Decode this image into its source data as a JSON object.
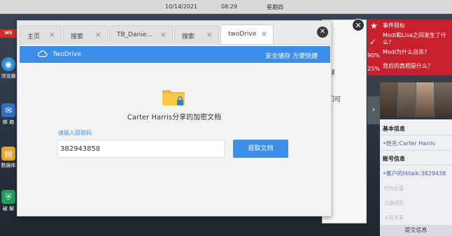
{
  "topbar": {
    "date": "10/14/2021",
    "time": "08:29",
    "weekday": "星期四"
  },
  "dock": {
    "news_badge": "WS",
    "items": [
      {
        "label": "浏览器",
        "icon": "globe-icon"
      },
      {
        "label": "邮 箱",
        "icon": "mail-icon"
      },
      {
        "label": "数据库",
        "icon": "database-icon"
      },
      {
        "label": "破 解",
        "icon": "shield-icon"
      }
    ]
  },
  "bgwin": {
    "text1": "推荐",
    "text2": "门可"
  },
  "tabs": [
    {
      "label": "主页"
    },
    {
      "label": "搜索"
    },
    {
      "label": "TB_Danie..."
    },
    {
      "label": "搜索"
    },
    {
      "label": "twoDrive"
    }
  ],
  "app": {
    "name": "TwoDrive",
    "slogan": "安全储存 方便快捷"
  },
  "share": {
    "caption": "Carter Harris分享的加密文档",
    "code_label": "请输入提取码",
    "code_value": "382943858",
    "button": "提取文档"
  },
  "right_panel": {
    "header": "事件目标",
    "questions": [
      "Modi和Lisa之间发生了什么？",
      "Modi为什么自杀?",
      "背后的真相是什么？"
    ],
    "pct1": "90%",
    "pct2": "25%",
    "basic_header": "基本信息",
    "name_line": "•姓名:Carter Harris",
    "account_header": "账号信息",
    "account_line": "•客户的Hitalk:3829438",
    "grey_items": [
      "行为记录",
      "注册经历",
      "人际关系"
    ],
    "submit": "提交信息"
  },
  "colors": {
    "accent": "#3d8ee8",
    "panel_red": "#c9202e"
  }
}
